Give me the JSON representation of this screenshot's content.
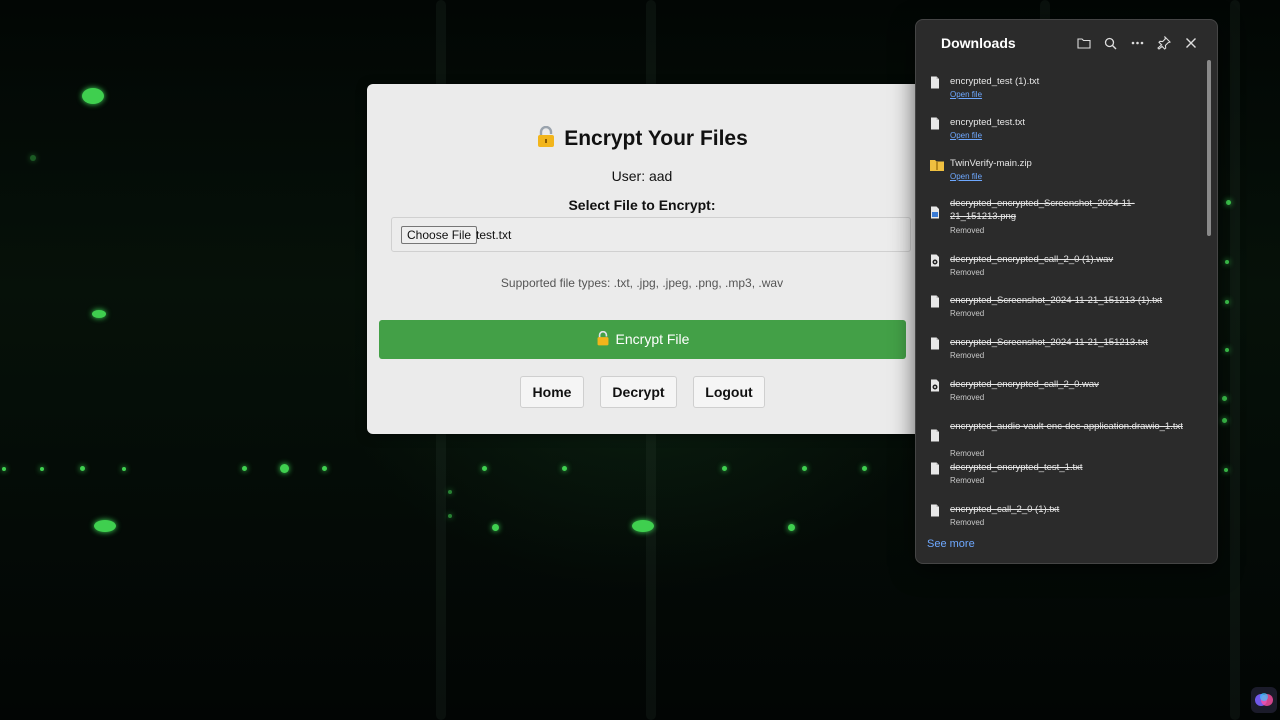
{
  "page": {
    "title": "Encrypt Your Files",
    "user_text": "User: aad",
    "select_label": "Select File to Encrypt:",
    "choose_button": "Choose File",
    "selected_file": "test.txt",
    "supported_text": "Supported file types: .txt, .jpg, .jpeg, .png, .mp3, .wav",
    "encrypt_button": "Encrypt File",
    "nav": {
      "home": "Home",
      "decrypt": "Decrypt",
      "logout": "Logout"
    }
  },
  "downloads": {
    "title": "Downloads",
    "tools": [
      "folder-icon",
      "search-icon",
      "more-icon",
      "pin-icon",
      "close-icon"
    ],
    "items": [
      {
        "name": "encrypted_test (1).txt",
        "status": "Open file",
        "removed": false,
        "icon": "text-file-icon"
      },
      {
        "name": "encrypted_test.txt",
        "status": "Open file",
        "removed": false,
        "icon": "text-file-icon"
      },
      {
        "name": "TwinVerify-main.zip",
        "status": "Open file",
        "removed": false,
        "icon": "zip-folder-icon"
      },
      {
        "name": "decrypted_encrypted_Screenshot_2024-11-21_151213.png",
        "status": "Removed",
        "removed": true,
        "icon": "image-file-icon"
      },
      {
        "name": "decrypted_encrypted_call_2_0 (1).wav",
        "status": "Removed",
        "removed": true,
        "icon": "audio-file-icon"
      },
      {
        "name": "encrypted_Screenshot_2024-11-21_151213 (1).txt",
        "status": "Removed",
        "removed": true,
        "icon": "text-file-icon"
      },
      {
        "name": "encrypted_Screenshot_2024-11-21_151213.txt",
        "status": "Removed",
        "removed": true,
        "icon": "text-file-icon"
      },
      {
        "name": "decrypted_encrypted_call_2_0.wav",
        "status": "Removed",
        "removed": true,
        "icon": "audio-file-icon"
      },
      {
        "name": "encrypted_audio-vault-enc-dec-application.drawio_1.txt",
        "status": "Removed",
        "removed": true,
        "icon": "text-file-icon"
      },
      {
        "name": "decrypted_encrypted_test_1.txt",
        "status": "Removed",
        "removed": true,
        "icon": "text-file-icon"
      },
      {
        "name": "encrypted_call_2_0 (1).txt",
        "status": "Removed",
        "removed": true,
        "icon": "text-file-icon"
      }
    ],
    "see_more": "See more"
  },
  "colors": {
    "accent_green": "#43a047",
    "link_blue": "#6ea8ff",
    "panel_bg": "#2b2b2b"
  }
}
